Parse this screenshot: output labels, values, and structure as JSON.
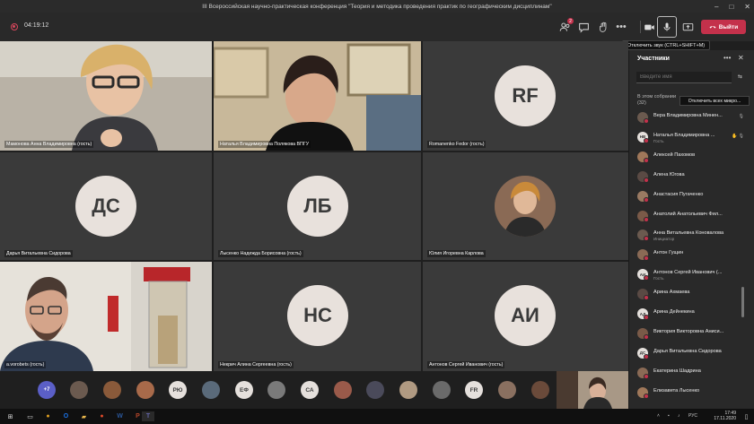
{
  "window": {
    "title": "III Всероссийская научно-практическая конференция \"Теория и методика проведения практик по географическим дисциплинам\""
  },
  "toolbar": {
    "timer": "04:19:12",
    "participants_badge": "2",
    "leave_label": "Выйти",
    "mute_tooltip": "Отключить звук (CTRL+SHIFT+M)"
  },
  "tiles": [
    {
      "name": "Мамонова Анна Владимировна (гость)",
      "initials": ""
    },
    {
      "name": "Наталья Владимировна Полякова ВПГУ",
      "initials": ""
    },
    {
      "name": "Romanenko Fedor (гость)",
      "initials": "RF"
    },
    {
      "name": "Дарья Витальевна Сидорова",
      "initials": "ДС"
    },
    {
      "name": "Лысенко Надежда Борисовна (гость)",
      "initials": "ЛБ"
    },
    {
      "name": "Юлия Игоревна Карлова",
      "initials": ""
    },
    {
      "name": "a.vorobets (гость)",
      "initials": ""
    },
    {
      "name": "Некрич Алина Сергеевна (гость)",
      "initials": "НС"
    },
    {
      "name": "Антонов Сергей Иванович (гость)",
      "initials": "АИ"
    }
  ],
  "strip": {
    "more": "+7",
    "initials": [
      "РЮ",
      "ЕФ",
      "СА",
      "FR"
    ]
  },
  "panel": {
    "title": "Участники",
    "search_placeholder": "Введите имя",
    "section_label": "В этом собрании",
    "section_count": "(32)",
    "mute_all": "Отключить всех микро...",
    "participants": [
      {
        "name": "Вера Владимировна Минен...",
        "sub": "",
        "initials": ""
      },
      {
        "name": "Наталья Владимировна ...",
        "sub": "Гость",
        "initials": "НВ"
      },
      {
        "name": "Алексей Пахомов",
        "sub": "",
        "initials": ""
      },
      {
        "name": "Алена Югова",
        "sub": "",
        "initials": ""
      },
      {
        "name": "Анастасия Пугаченко",
        "sub": "",
        "initials": ""
      },
      {
        "name": "Анатолий Анатольевич Фил...",
        "sub": "",
        "initials": ""
      },
      {
        "name": "Анна Витальевна Коновалова",
        "sub": "Инициатор",
        "initials": ""
      },
      {
        "name": "Антон Гущин",
        "sub": "",
        "initials": ""
      },
      {
        "name": "Антонов Сергей Иванович (...",
        "sub": "Гость",
        "initials": "АИ"
      },
      {
        "name": "Арина Ахмаева",
        "sub": "",
        "initials": ""
      },
      {
        "name": "Арина Дейнекина",
        "sub": "",
        "initials": "АД"
      },
      {
        "name": "Виктория Викторовна Аниси...",
        "sub": "",
        "initials": ""
      },
      {
        "name": "Дарья Витальевна Сидорова",
        "sub": "",
        "initials": "ДС"
      },
      {
        "name": "Екатерина Шадрина",
        "sub": "",
        "initials": ""
      },
      {
        "name": "Елизавета Лысенко",
        "sub": "",
        "initials": ""
      }
    ]
  },
  "taskbar": {
    "lang": "РУС",
    "time": "17:49",
    "date": "17.11.2020"
  },
  "colors": {
    "leave": "#c4314b",
    "accent": "#5b5fc7"
  }
}
